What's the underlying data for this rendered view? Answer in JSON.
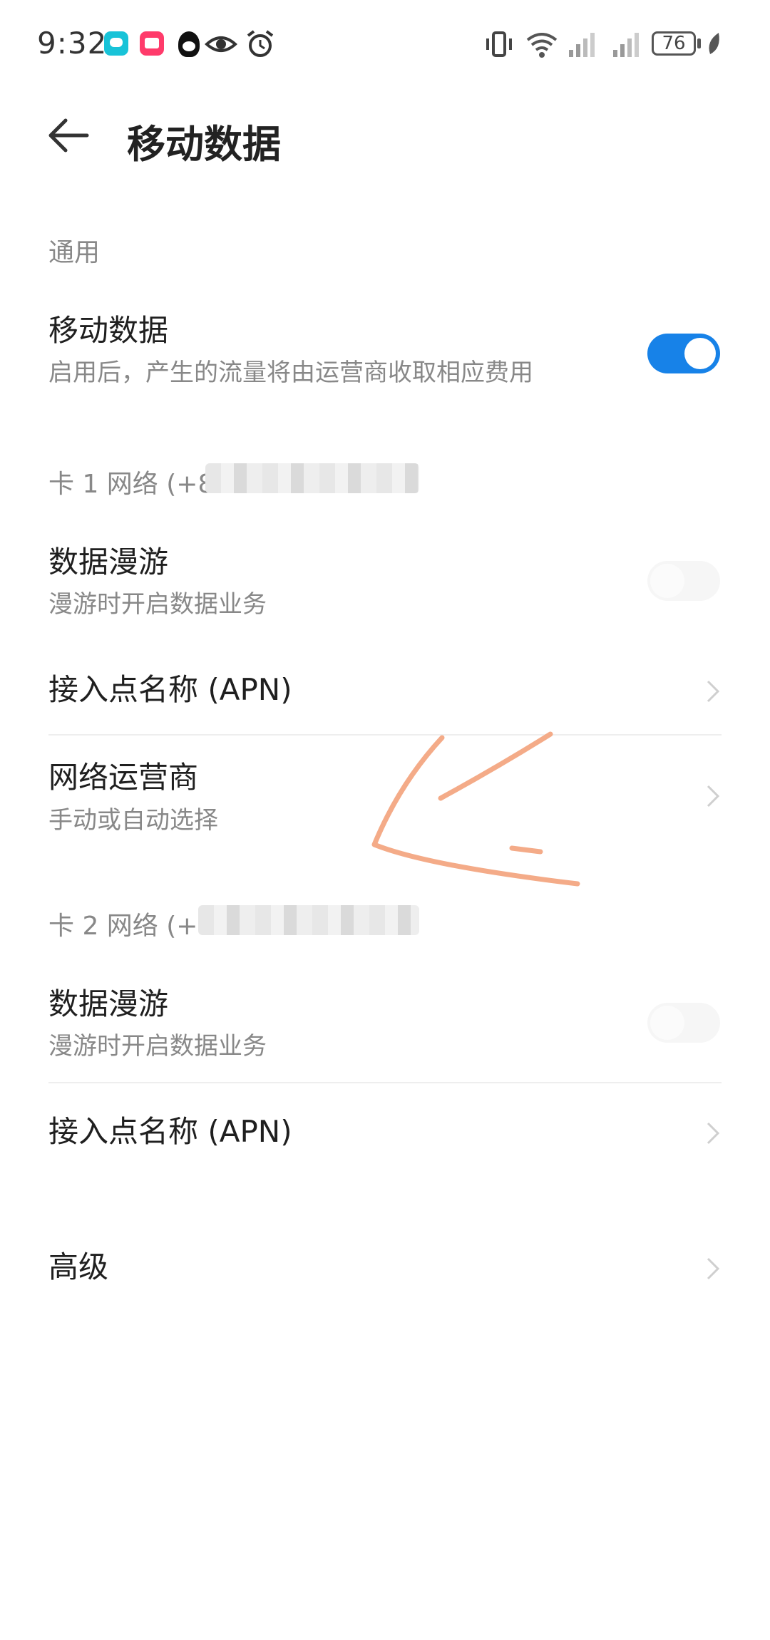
{
  "status_bar": {
    "time": "9:32",
    "battery": "76",
    "icons": [
      "message-app-icon",
      "mail-app-icon",
      "qq-icon",
      "eye-icon",
      "alarm-icon",
      "vibrate-icon",
      "wifi-icon",
      "signal-icon",
      "signal-icon",
      "battery-icon",
      "leaf-icon"
    ]
  },
  "header": {
    "title": "移动数据"
  },
  "general": {
    "label": "通用",
    "mobile_data": {
      "title": "移动数据",
      "subtitle": "启用后，产生的流量将由运营商收取相应费用",
      "enabled": true
    }
  },
  "sim1": {
    "label": "卡 1 网络 (+8",
    "roaming": {
      "title": "数据漫游",
      "subtitle": "漫游时开启数据业务",
      "enabled": false
    },
    "apn": {
      "title": "接入点名称 (APN)"
    },
    "carrier": {
      "title": "网络运营商",
      "subtitle": "手动或自动选择"
    }
  },
  "sim2": {
    "label": "卡 2 网络 (+8",
    "roaming": {
      "title": "数据漫游",
      "subtitle": "漫游时开启数据业务",
      "enabled": false
    },
    "apn": {
      "title": "接入点名称 (APN)"
    }
  },
  "advanced": {
    "title": "高级"
  },
  "colors": {
    "accent": "#1782e8",
    "annotation": "#f4ab88"
  }
}
